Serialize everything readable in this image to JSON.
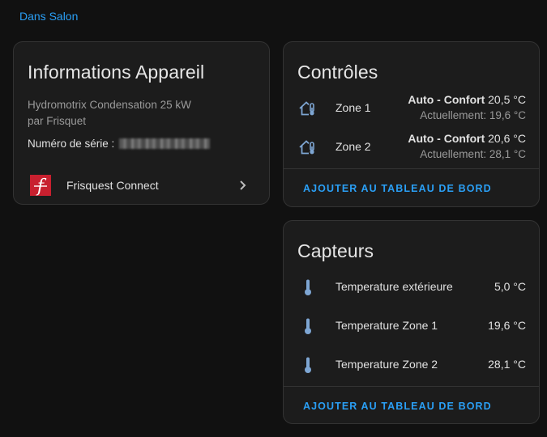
{
  "area_link": "Dans Salon",
  "device_card": {
    "title": "Informations Appareil",
    "model": "Hydromotrix Condensation 25 kW",
    "manufacturer": "par Frisquet",
    "serial_label": "Numéro de série :",
    "integration": {
      "name": "Frisquest Connect",
      "logo_letter": "f",
      "logo_color": "#c8202f"
    }
  },
  "controls_card": {
    "title": "Contrôles",
    "items": [
      {
        "name": "Zone 1",
        "mode": "Auto - Confort",
        "target": "20,5 °C",
        "current": "Actuellement: 19,6 °C",
        "icon": "thermostat-home-icon"
      },
      {
        "name": "Zone 2",
        "mode": "Auto - Confort",
        "target": "20,6 °C",
        "current": "Actuellement: 28,1 °C",
        "icon": "thermostat-home-icon"
      }
    ],
    "action": "AJOUTER AU TABLEAU DE BORD"
  },
  "sensors_card": {
    "title": "Capteurs",
    "items": [
      {
        "name": "Temperature extérieure",
        "value": "5,0 °C",
        "icon": "thermometer-icon"
      },
      {
        "name": "Temperature Zone 1",
        "value": "19,6 °C",
        "icon": "thermometer-icon"
      },
      {
        "name": "Temperature Zone 2",
        "value": "28,1 °C",
        "icon": "thermometer-icon"
      }
    ],
    "action": "AJOUTER AU TABLEAU DE BORD"
  },
  "colors": {
    "accent": "#2a9ff5",
    "icon": "#7ea6d3",
    "card_bg": "#1c1c1c",
    "page_bg": "#111111"
  }
}
